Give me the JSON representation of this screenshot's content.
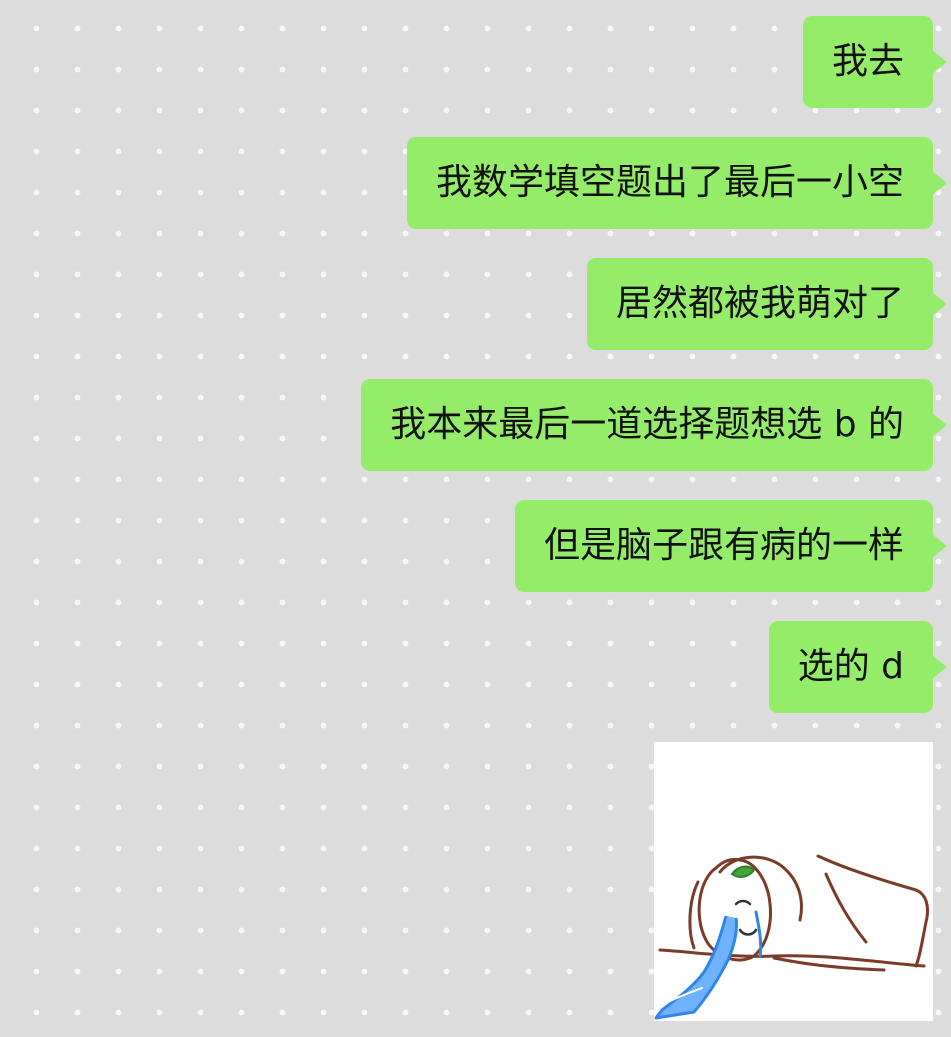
{
  "chat": {
    "messages": [
      {
        "text": "我去"
      },
      {
        "text": "我数学填空题出了最后一小空"
      },
      {
        "text": "居然都被我萌对了"
      },
      {
        "text": "我本来最后一道选择题想选 b 的"
      },
      {
        "text": "但是脑子跟有病的一样"
      },
      {
        "text": "选的 d"
      }
    ],
    "sticker": {
      "icon": "crying-cartoon-sticker"
    }
  },
  "colors": {
    "background": "#dcdcdc",
    "dot": "#f7f7f7",
    "outgoing_bubble": "#95ec69",
    "text": "#111111"
  }
}
